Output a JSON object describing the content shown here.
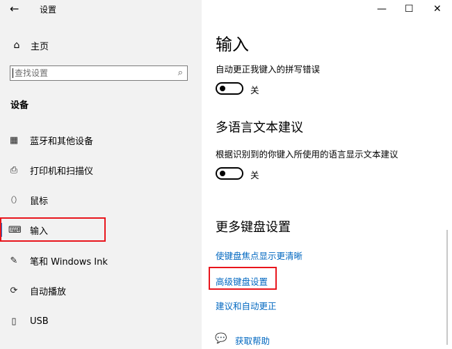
{
  "window": {
    "title": "设置",
    "back_glyph": "←",
    "minimize_glyph": "—",
    "maximize_glyph": "☐",
    "close_glyph": "✕"
  },
  "sidebar": {
    "home_label": "主页",
    "search_placeholder": "查找设置",
    "section_title": "设备",
    "items": [
      {
        "label": "蓝牙和其他设备",
        "icon": "bluetooth-devices-icon",
        "glyph": "▦"
      },
      {
        "label": "打印机和扫描仪",
        "icon": "printer-icon",
        "glyph": "⎙"
      },
      {
        "label": "鼠标",
        "icon": "mouse-icon",
        "glyph": "⬯"
      },
      {
        "label": "输入",
        "icon": "keyboard-icon",
        "glyph": "⌨",
        "selected": true
      },
      {
        "label": "笔和 Windows Ink",
        "icon": "pen-icon",
        "glyph": "✎"
      },
      {
        "label": "自动播放",
        "icon": "autoplay-icon",
        "glyph": "⟳"
      },
      {
        "label": "USB",
        "icon": "usb-icon",
        "glyph": "▯"
      }
    ]
  },
  "main": {
    "title": "输入",
    "autocorrect": {
      "label": "自动更正我键入的拼写错误",
      "state": "关",
      "on": false
    },
    "multilingual": {
      "title": "多语言文本建议",
      "label": "根据识别到的你键入所使用的语言显示文本建议",
      "state": "关",
      "on": false
    },
    "more_keyboard": {
      "title": "更多键盘设置",
      "links": [
        "使键盘焦点显示更清晰",
        "高级键盘设置",
        "建议和自动更正"
      ]
    },
    "help_label": "获取帮助"
  },
  "colors": {
    "sidebar_bg": "#f2f2f2",
    "accent": "#0078d7",
    "link": "#0067c0",
    "highlight": "#e8141b"
  }
}
